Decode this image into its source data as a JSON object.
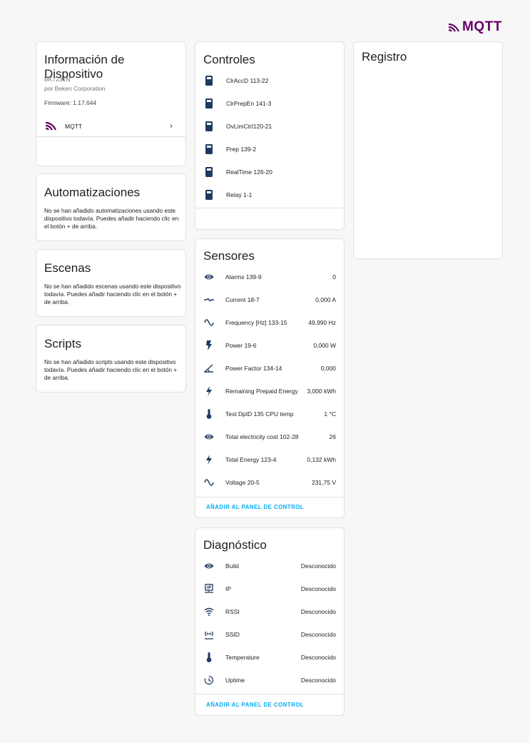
{
  "brand": {
    "logo_text": "MQTT",
    "color": "#660066",
    "accent": "#03a9f4",
    "icon_color": "#1e3a5f"
  },
  "device": {
    "title": "Información de Dispositivo",
    "model": "BK7231N",
    "manufacturer": "por Beken Corporation",
    "firmware": "Firmware: 1.17.644",
    "integration_label": "MQTT"
  },
  "automations": {
    "title": "Automatizaciones",
    "text": "No se han añadido automatizaciones usando este dispositivo todavía. Puedes añadir haciendo clic en el botón + de arriba."
  },
  "scenes": {
    "title": "Escenas",
    "text": "No se han añadido escenas usando este dispositivo todavía. Puedes añadir haciendo clic en el botón + de arriba."
  },
  "scripts": {
    "title": "Scripts",
    "text": "No se han añadido scripts usando este dispositivo todavía. Puedes añadir haciendo clic en el botón + de arriba."
  },
  "controls": {
    "title": "Controles",
    "items": [
      {
        "label": "ClrAccD 113-22",
        "icon": "switch-icon"
      },
      {
        "label": "ClrPrepEn 141-3",
        "icon": "switch-icon"
      },
      {
        "label": "OvLimCtrl120-21",
        "icon": "switch-icon"
      },
      {
        "label": "Prep 139-2",
        "icon": "switch-icon"
      },
      {
        "label": "RealTime 126-20",
        "icon": "switch-icon"
      },
      {
        "label": "Relay 1-1",
        "icon": "switch-icon"
      }
    ]
  },
  "sensors": {
    "title": "Sensores",
    "items": [
      {
        "name": "Alarms 139-9",
        "value": "0",
        "icon": "eye-icon"
      },
      {
        "name": "Current 18-7",
        "value": "0,000 A",
        "icon": "current-icon"
      },
      {
        "name": "Frequency [Hz] 133-15",
        "value": "49,990 Hz",
        "icon": "sine-wave-icon"
      },
      {
        "name": "Power 19-6",
        "value": "0,000 W",
        "icon": "flash-icon"
      },
      {
        "name": "Power Factor 134-14",
        "value": "0,000",
        "icon": "angle-icon"
      },
      {
        "name": "Remaining Prepaid Energy",
        "value": "3,000 kWh",
        "icon": "lightning-icon"
      },
      {
        "name": "Test DpID 135 CPU temp",
        "value": "1 °C",
        "icon": "thermometer-icon"
      },
      {
        "name": "Total electricity cost 102-28",
        "value": "26",
        "icon": "eye-icon"
      },
      {
        "name": "Total Energy 123-4",
        "value": "0,132 kWh",
        "icon": "lightning-icon"
      },
      {
        "name": "Voltage 20-5",
        "value": "231,75 V",
        "icon": "sine-wave-icon"
      }
    ],
    "add_label": "AÑADIR AL PANEL DE CONTROL"
  },
  "diagnostics": {
    "title": "Diagnóstico",
    "items": [
      {
        "name": "Build",
        "value": "Desconocido",
        "icon": "eye-icon"
      },
      {
        "name": "IP",
        "value": "Desconocido",
        "icon": "ip-network-icon"
      },
      {
        "name": "RSSI",
        "value": "Desconocido",
        "icon": "wifi-icon"
      },
      {
        "name": "SSID",
        "value": "Desconocido",
        "icon": "access-point-icon"
      },
      {
        "name": "Temperature",
        "value": "Desconocido",
        "icon": "thermometer-icon"
      },
      {
        "name": "Uptime",
        "value": "Desconocido",
        "icon": "clock-icon"
      }
    ],
    "add_label": "AÑADIR AL PANEL DE CONTROL"
  },
  "log": {
    "title": "Registro"
  }
}
